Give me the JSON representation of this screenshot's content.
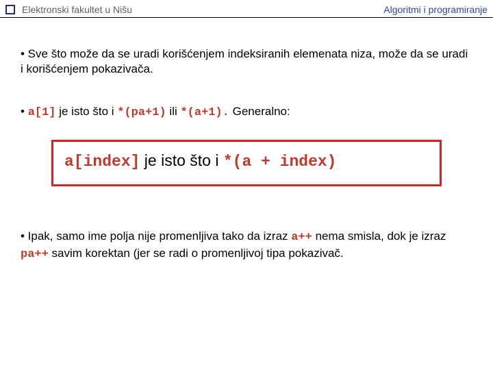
{
  "header": {
    "left": "Elektronski fakultet u Nišu",
    "right": "Algoritmi i programiranje"
  },
  "p1": {
    "text": "• Sve što može da se uradi korišćenjem indeksiranih elemenata niza, može da se uradi i korišćenjem pokazivača."
  },
  "p2": {
    "lead": "• ",
    "c1": "a[1]",
    "t1": " je isto što i ",
    "c2": "*(pa+1)",
    "t2": " ili ",
    "c3": "*(a+1).",
    "t3": " Generalno:"
  },
  "box": {
    "c1": "a[index]",
    "t1": " je isto što i ",
    "c2": "*(a + index)"
  },
  "p3": {
    "t1": "• Ipak, samo ime polja nije promenljiva tako da izraz ",
    "c1": "a++",
    "t2": " nema smisla, dok je izraz ",
    "c2": "pa++",
    "t3": " savim korektan (jer se radi o promenljivoj tipa pokazivač."
  }
}
